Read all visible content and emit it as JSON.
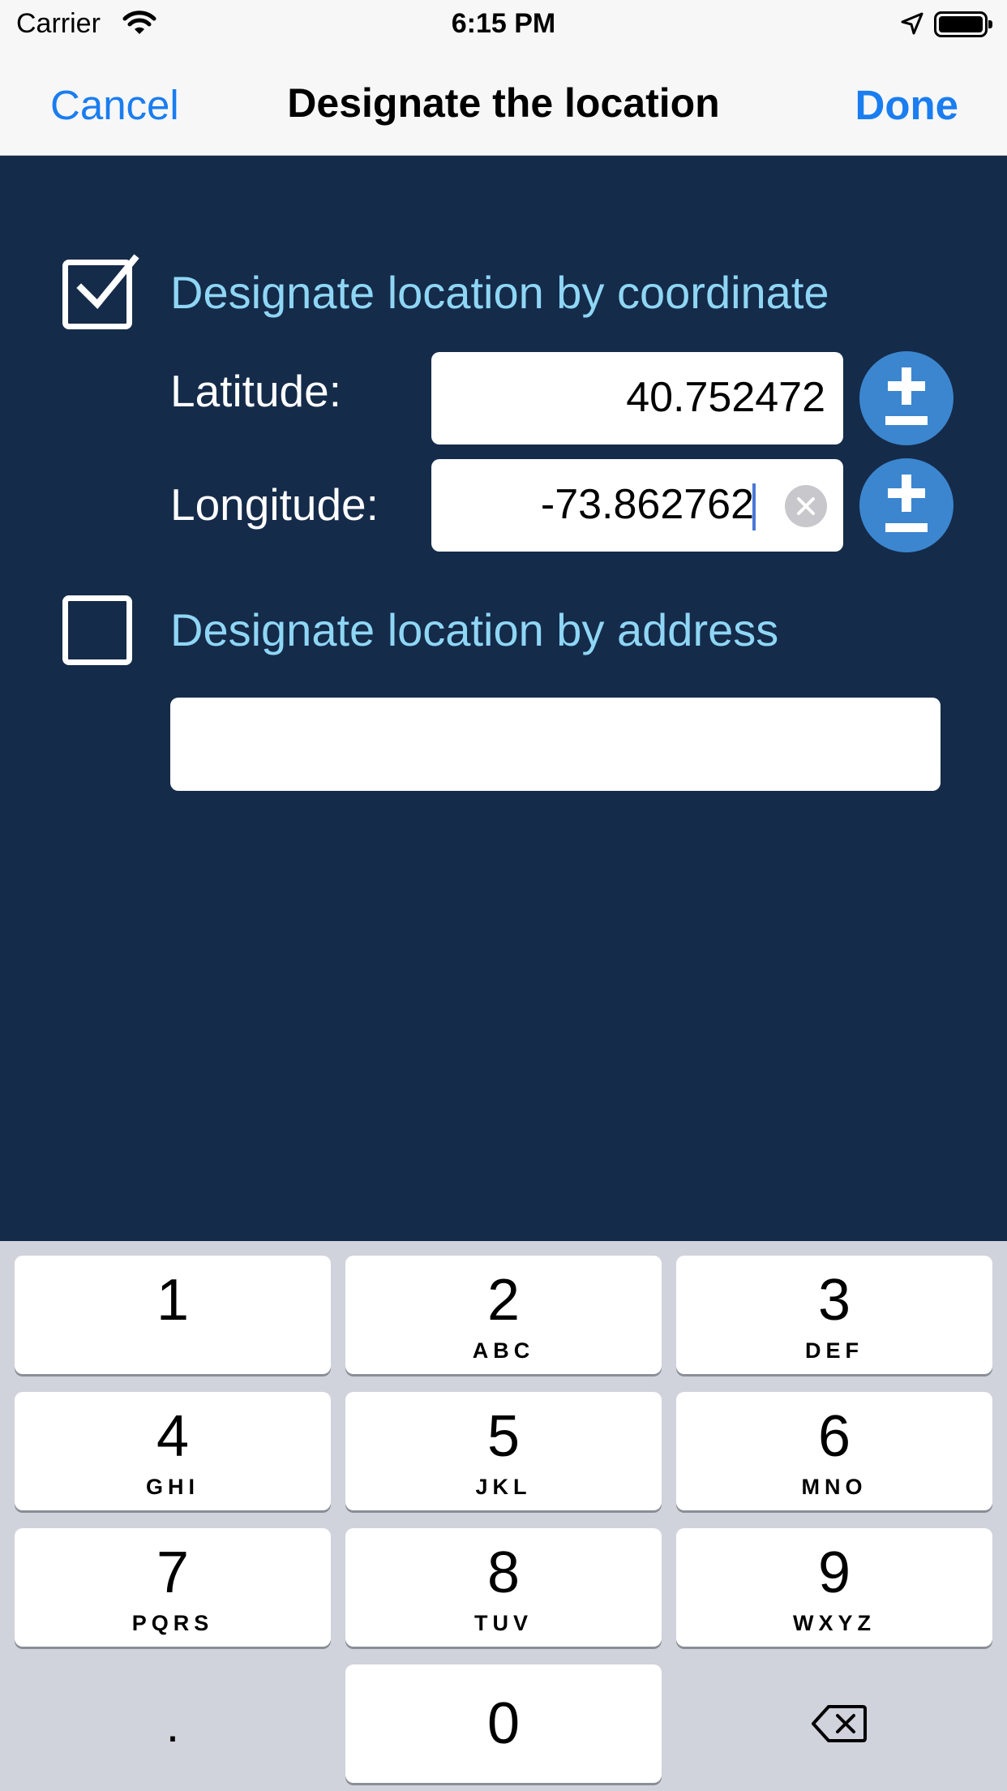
{
  "status_bar": {
    "carrier": "Carrier",
    "time": "6:15 PM"
  },
  "nav": {
    "cancel_label": "Cancel",
    "title": "Designate the location",
    "done_label": "Done"
  },
  "form": {
    "by_coordinate": {
      "label": "Designate location by coordinate",
      "checked": true
    },
    "latitude": {
      "label": "Latitude:",
      "value": "40.752472"
    },
    "longitude": {
      "label": "Longitude:",
      "value": "-73.862762"
    },
    "by_address": {
      "label": "Designate location by address",
      "checked": false,
      "value": ""
    }
  },
  "keyboard": {
    "keys": [
      {
        "num": "1",
        "letters": ""
      },
      {
        "num": "2",
        "letters": "ABC"
      },
      {
        "num": "3",
        "letters": "DEF"
      },
      {
        "num": "4",
        "letters": "GHI"
      },
      {
        "num": "5",
        "letters": "JKL"
      },
      {
        "num": "6",
        "letters": "MNO"
      },
      {
        "num": "7",
        "letters": "PQRS"
      },
      {
        "num": "8",
        "letters": "TUV"
      },
      {
        "num": "9",
        "letters": "WXYZ"
      },
      {
        "num": "0",
        "letters": ""
      }
    ],
    "decimal": "."
  },
  "colors": {
    "background": "#152b4a",
    "accent_blue": "#1a7df0",
    "option_label": "#8fd6f5",
    "plus_minus_button": "#3b86cf"
  },
  "icons": [
    "wifi-icon",
    "location-arrow-icon",
    "battery-icon",
    "checkmark-icon",
    "clear-icon",
    "plus-minus-icon",
    "delete-icon"
  ]
}
